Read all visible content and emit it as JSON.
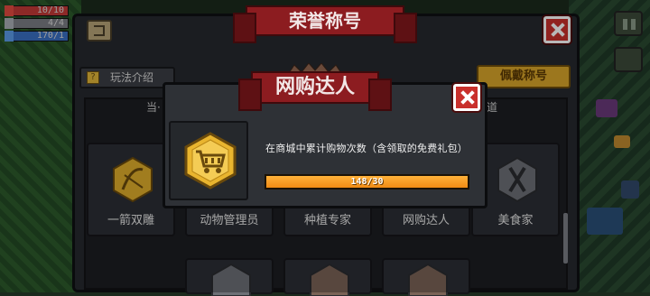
{
  "hud": {
    "hp": "10/10",
    "armor": "4/4",
    "energy": "170/1"
  },
  "header": {
    "title": "荣誉称号",
    "intro_label": "玩法介绍",
    "equip_label": "佩戴称号"
  },
  "grid": {
    "top_row_partial": [
      "当·",
      "道"
    ],
    "tiles": [
      {
        "name": "一箭双雕",
        "emblem": "bow-badge-icon"
      },
      {
        "name": "动物管理员",
        "emblem": "animal-badge-icon"
      },
      {
        "name": "种植专家",
        "emblem": "plant-badge-icon"
      },
      {
        "name": "网购达人",
        "emblem": "cart-badge-icon"
      },
      {
        "name": "美食家",
        "emblem": "fork-knife-badge-icon"
      }
    ]
  },
  "modal": {
    "title": "网购达人",
    "description": "在商城中累计购物次数（含领取的免费礼包）",
    "progress_text": "148/30",
    "progress_fraction": 1.0
  },
  "colors": {
    "ribbon_red": "#8c1c20",
    "gold": "#d9a52a",
    "progress_orange": "#f08a14",
    "close_red": "#c9302c"
  }
}
